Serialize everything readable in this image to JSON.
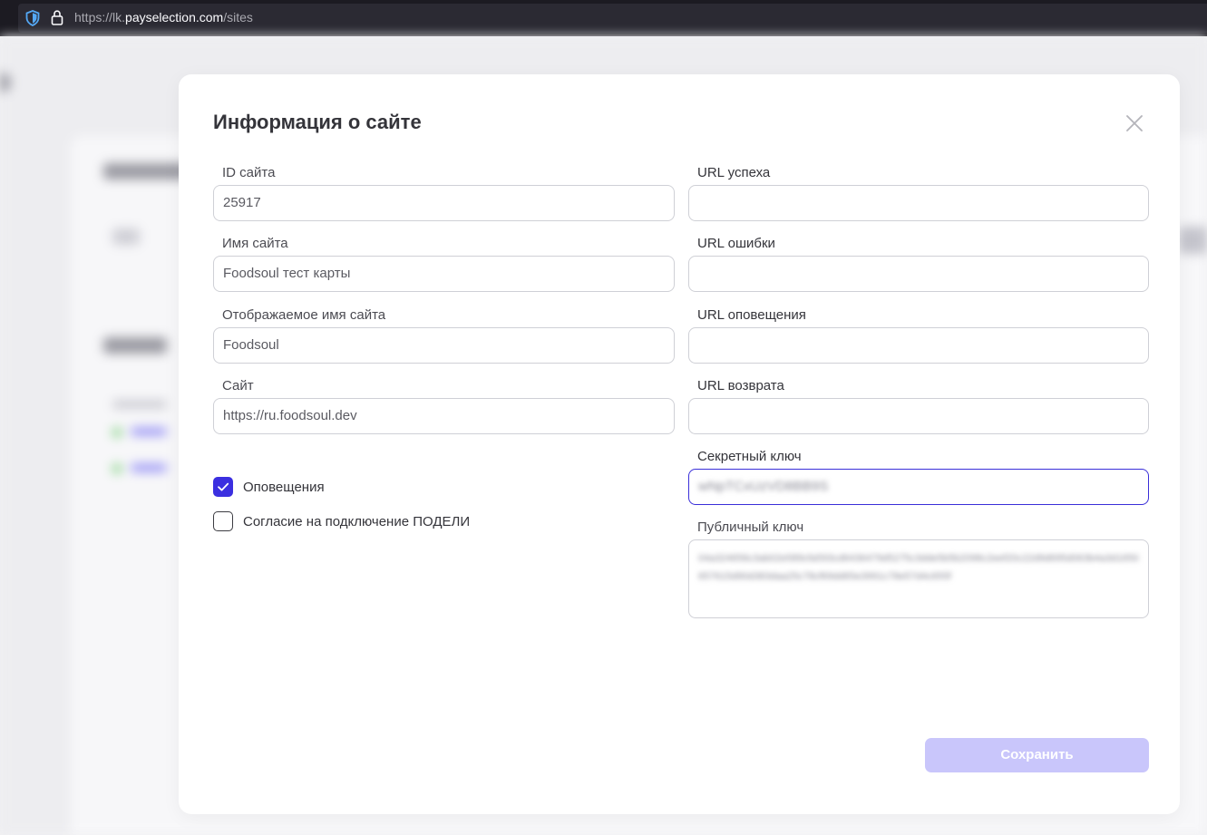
{
  "browser": {
    "url_prefix": "https://lk.",
    "url_domain": "payselection.com",
    "url_path": "/sites"
  },
  "modal": {
    "title": "Информация о сайте",
    "left_fields": [
      {
        "label": "ID сайта",
        "value": "25917"
      },
      {
        "label": "Имя сайта",
        "value": "Foodsoul тест карты"
      },
      {
        "label": "Отображаемое имя сайта",
        "value": "Foodsoul"
      },
      {
        "label": "Сайт",
        "value": "https://ru.foodsoul.dev"
      }
    ],
    "right_fields": [
      {
        "label": "URL успеха",
        "value": ""
      },
      {
        "label": "URL ошибки",
        "value": ""
      },
      {
        "label": "URL оповещения",
        "value": ""
      },
      {
        "label": "URL возврата",
        "value": ""
      },
      {
        "label": "Секретный ключ",
        "value": "wNpTCxUzVD8BB9S"
      },
      {
        "label": "Публичный ключ",
        "value": "04a324656c3ab02e589cfa593cd6436479d5275c3dde5b5b2098c2eef20c22d9d695d063b4a3d1650657615d90d383daa25c78cf69dd65e3991c78e57d4c655f"
      }
    ],
    "checkboxes": [
      {
        "label": "Оповещения",
        "checked": true
      },
      {
        "label": "Согласие на подключение ПОДЕЛИ",
        "checked": false
      }
    ],
    "save_label": "Сохранить"
  },
  "colors": {
    "accent": "#3b2fe0",
    "save_disabled": "#c9c6fb"
  }
}
